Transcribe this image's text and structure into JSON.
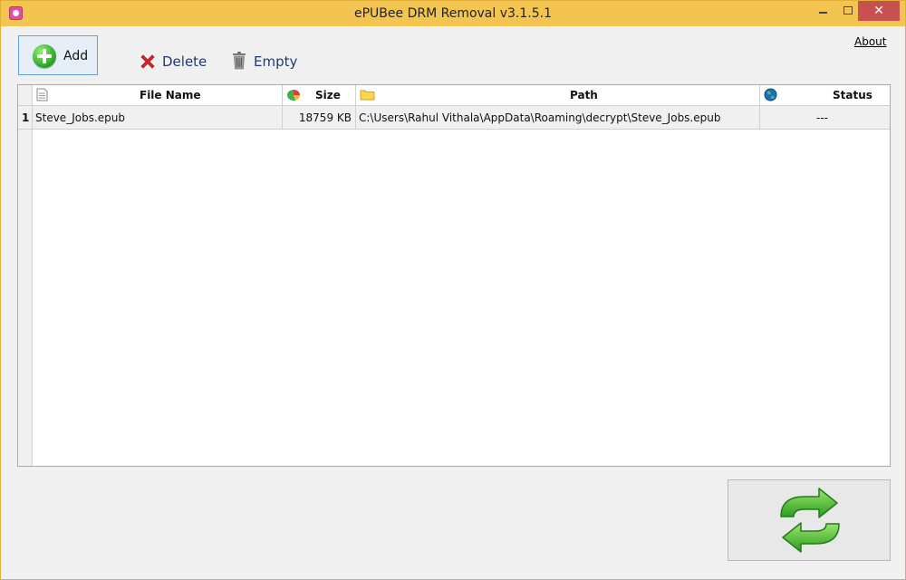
{
  "window": {
    "title": "ePUBee DRM Removal v3.1.5.1",
    "colors": {
      "titlebar": "#f3c550",
      "close": "#c75050",
      "accent_green": "#2aa12a"
    }
  },
  "toolbar": {
    "add_label": "Add",
    "delete_label": "Delete",
    "empty_label": "Empty",
    "about_label": "About"
  },
  "grid": {
    "columns": [
      {
        "key": "file_name",
        "label": "File Name",
        "icon": "document-icon"
      },
      {
        "key": "size",
        "label": "Size",
        "icon": "pie-chart-icon"
      },
      {
        "key": "path",
        "label": "Path",
        "icon": "folder-icon"
      },
      {
        "key": "status",
        "label": "Status",
        "icon": "globe-icon"
      }
    ],
    "rows": [
      {
        "index": "1",
        "file_name": "Steve_Jobs.epub",
        "size": "18759 KB",
        "path": "C:\\Users\\Rahul Vithala\\AppData\\Roaming\\decrypt\\Steve_Jobs.epub",
        "status": "---"
      }
    ]
  },
  "actions": {
    "convert_icon": "convert-arrows-icon"
  }
}
